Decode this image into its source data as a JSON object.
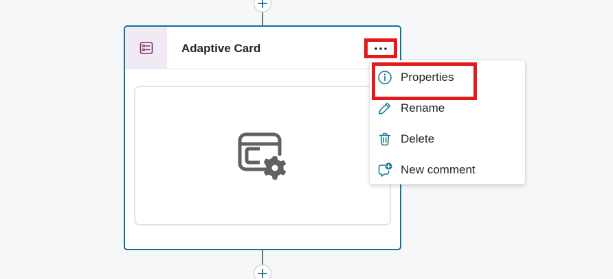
{
  "card": {
    "title": "Adaptive Card",
    "icon": "form-card-icon",
    "body_icon": "window-settings-icon",
    "more_icon": "more-horizontal-icon"
  },
  "context_menu": {
    "items": [
      {
        "label": "Properties",
        "icon": "info-icon",
        "highlighted": true
      },
      {
        "label": "Rename",
        "icon": "pencil-icon",
        "highlighted": false
      },
      {
        "label": "Delete",
        "icon": "trash-icon",
        "highlighted": false
      },
      {
        "label": "New comment",
        "icon": "comment-add-icon",
        "highlighted": false
      }
    ]
  },
  "colors": {
    "accent": "#0e7490",
    "icon_teal": "#0f6cbd",
    "highlight_red": "#e21a1a",
    "card_icon_bg": "#f1e9f3",
    "card_icon_purple": "#7a2e6e",
    "body_icon_gray": "#616161"
  }
}
